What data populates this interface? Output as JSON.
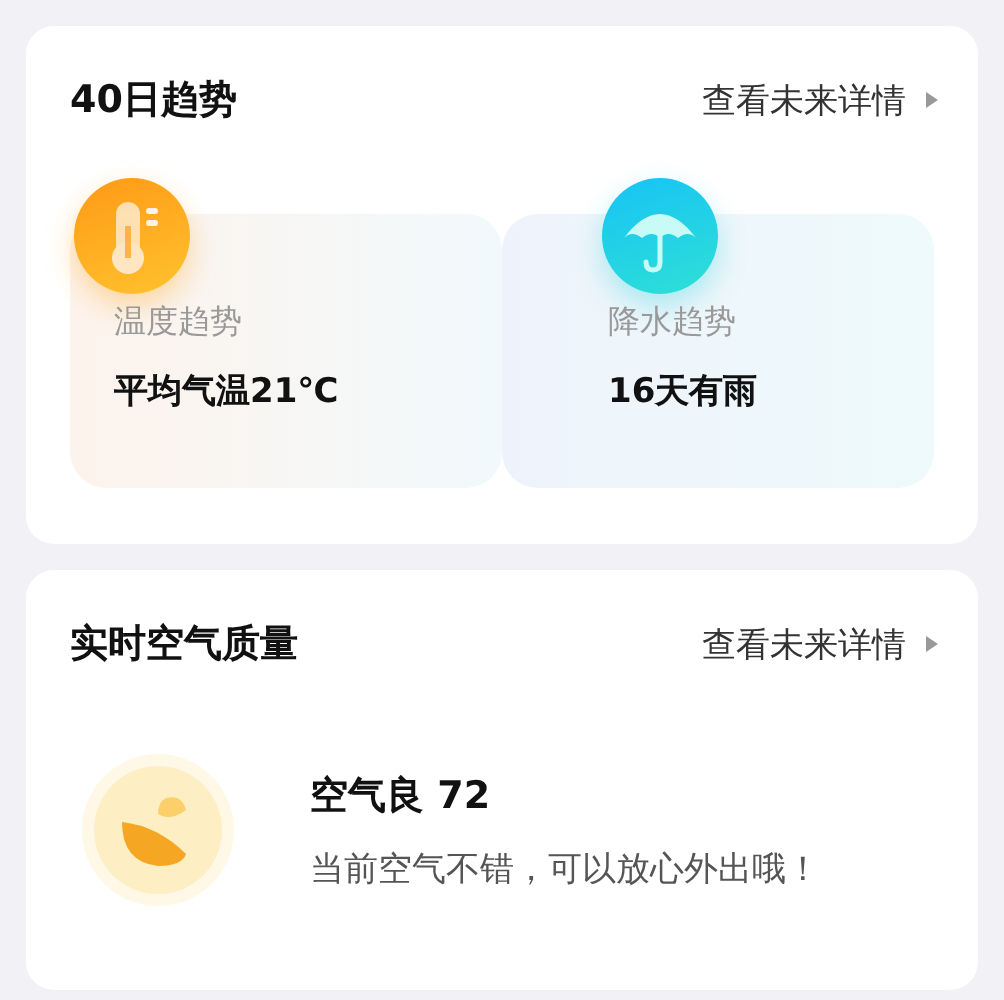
{
  "trend": {
    "title": "40日趋势",
    "more": "查看未来详情",
    "items": [
      {
        "kind": "temperature",
        "label": "温度趋势",
        "value": "平均气温21℃"
      },
      {
        "kind": "precipitation",
        "label": "降水趋势",
        "value": "16天有雨"
      }
    ]
  },
  "air": {
    "title": "实时空气质量",
    "more": "查看未来详情",
    "headline": "空气良 72",
    "message": "当前空气不错，可以放心外出哦！"
  }
}
